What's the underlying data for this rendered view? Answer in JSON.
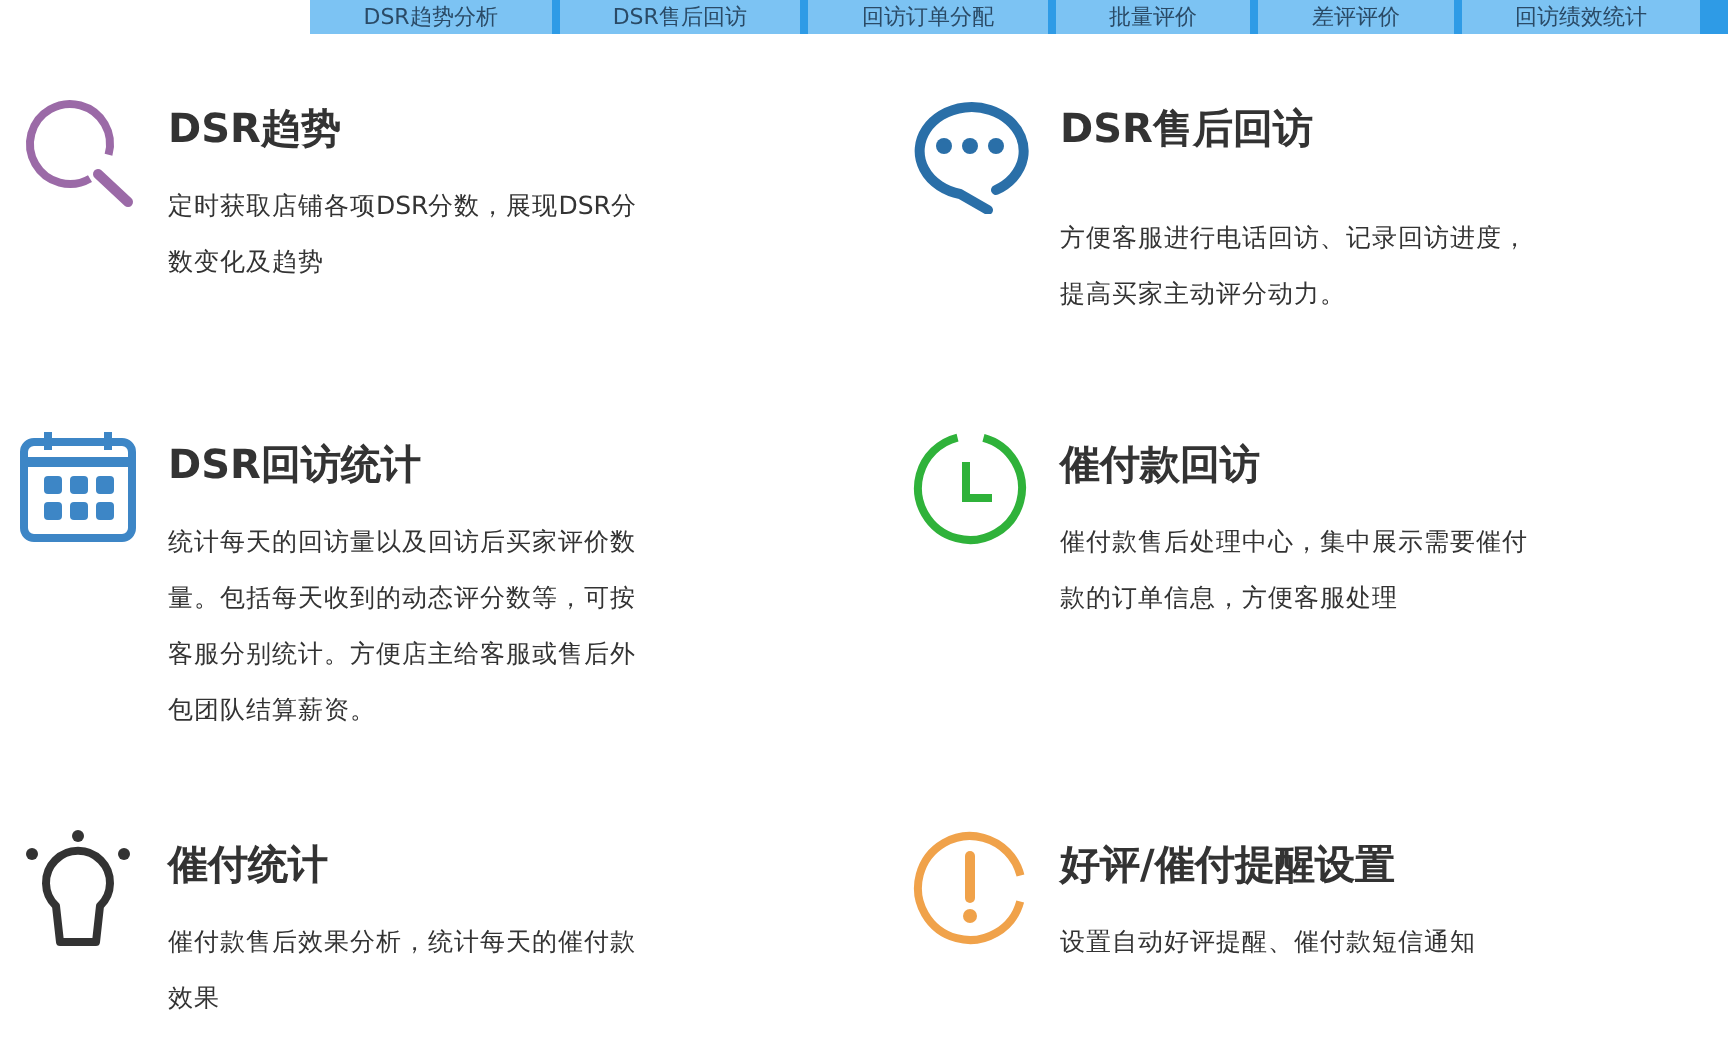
{
  "tabs": [
    {
      "label": "DSR趋势分析"
    },
    {
      "label": "DSR售后回访"
    },
    {
      "label": "回访订单分配"
    },
    {
      "label": "批量评价"
    },
    {
      "label": "差评评价"
    },
    {
      "label": "回访绩效统计"
    }
  ],
  "features": [
    {
      "kind": "search",
      "color": "#9b6aa7",
      "title": "DSR趋势",
      "description": [
        "定时获取店铺各项DSR分数，展现DSR分",
        "数变化及趋势"
      ]
    },
    {
      "kind": "chat",
      "color": "#2a6fa8",
      "title": "DSR售后回访",
      "description": [
        "方便客服进行电话回访、记录回访进度，",
        "提高买家主动评分动力。"
      ]
    },
    {
      "kind": "calendar",
      "color": "#3d86c6",
      "title": "DSR回访统计",
      "description": [
        "统计每天的回访量以及回访后买家评价数",
        "量。包括每天收到的动态评分数等，可按",
        "客服分别统计。方便店主给客服或售后外",
        "包团队结算薪资。"
      ]
    },
    {
      "kind": "clock",
      "color": "#2fb23a",
      "title": "催付款回访",
      "description": [
        "催付款售后处理中心，集中展示需要催付",
        "款的订单信息，方便客服处理"
      ]
    },
    {
      "kind": "bulb",
      "color": "#333333",
      "title": "催付统计",
      "description": [
        "催付款售后效果分析，统计每天的催付款",
        "效果"
      ]
    },
    {
      "kind": "alert",
      "color": "#f0a24a",
      "title": "好评/催付提醒设置",
      "description": [
        "设置自动好评提醒、催付款短信通知"
      ]
    }
  ]
}
